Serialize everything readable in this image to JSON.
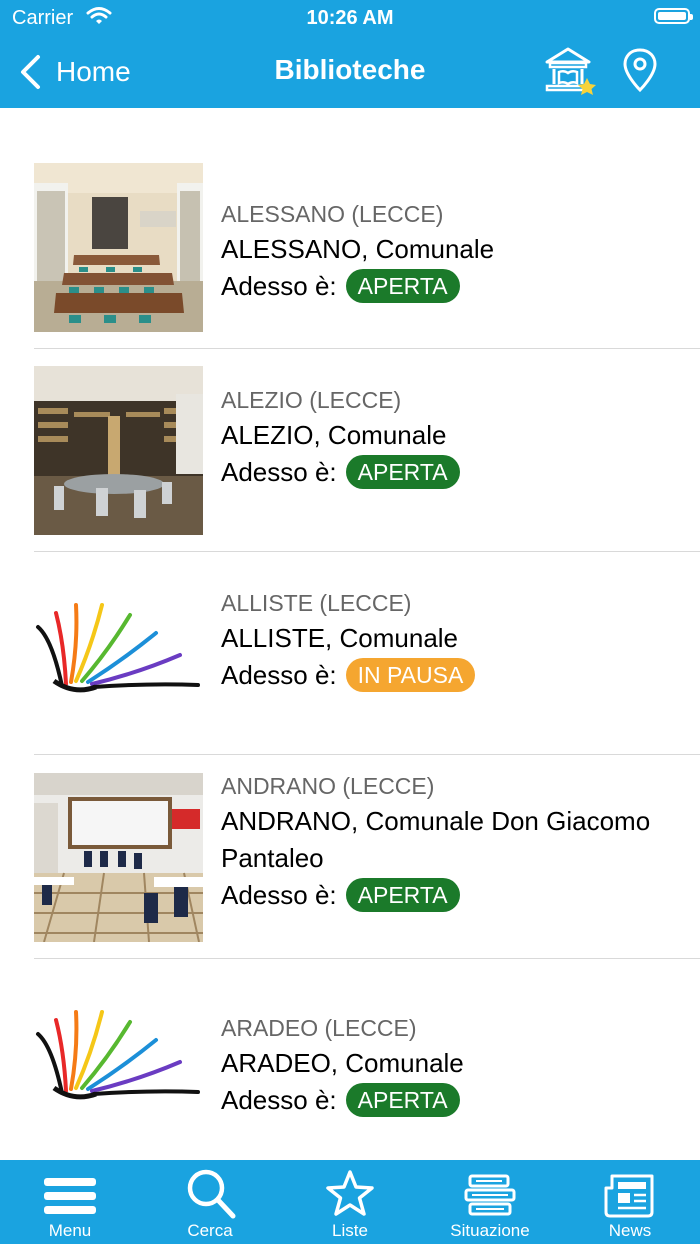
{
  "status_bar": {
    "carrier": "Carrier",
    "time": "10:26 AM"
  },
  "nav": {
    "back_label": "Home",
    "title": "Biblioteche",
    "icons": [
      "library-star-icon",
      "map-pin-icon"
    ]
  },
  "libraries": [
    {
      "location": "ALESSANO (LECCE)",
      "name": "ALESSANO, Comunale",
      "status_prefix": "Adesso è:",
      "status": "APERTA",
      "status_color": "#1b7a2a",
      "image": "photo"
    },
    {
      "location": "ALEZIO (LECCE)",
      "name": "ALEZIO, Comunale",
      "status_prefix": "Adesso è:",
      "status": "APERTA",
      "status_color": "#1b7a2a",
      "image": "photo"
    },
    {
      "location": "ALLISTE (LECCE)",
      "name": "ALLISTE, Comunale",
      "status_prefix": "Adesso è:",
      "status": "IN PAUSA",
      "status_color": "#f5a630",
      "image": "rainbow-book-logo"
    },
    {
      "location": "ANDRANO (LECCE)",
      "name": "ANDRANO, Comunale Don Giacomo Pantaleo",
      "status_prefix": "Adesso è:",
      "status": "APERTA",
      "status_color": "#1b7a2a",
      "image": "photo"
    },
    {
      "location": "ARADEO (LECCE)",
      "name": "ARADEO, Comunale",
      "status_prefix": "Adesso è:",
      "status": "APERTA",
      "status_color": "#1b7a2a",
      "image": "rainbow-book-logo"
    }
  ],
  "tabbar": [
    {
      "label": "Menu",
      "icon": "hamburger-icon"
    },
    {
      "label": "Cerca",
      "icon": "search-icon"
    },
    {
      "label": "Liste",
      "icon": "star-icon"
    },
    {
      "label": "Situazione",
      "icon": "books-stack-icon"
    },
    {
      "label": "News",
      "icon": "newspaper-icon"
    }
  ],
  "colors": {
    "bar": "#1aa3e0",
    "open": "#1b7a2a",
    "pause": "#f5a630"
  }
}
